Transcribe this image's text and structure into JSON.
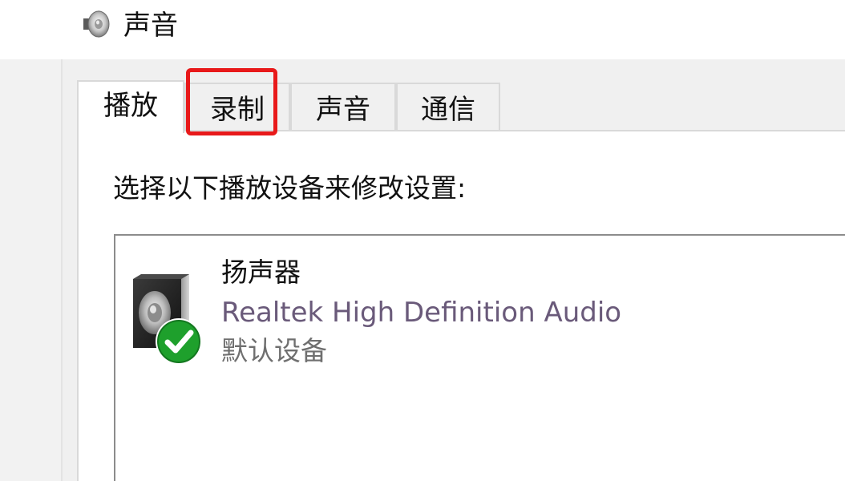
{
  "window": {
    "title": "声音",
    "icon": "speaker-icon"
  },
  "tabs": [
    {
      "label": "播放",
      "active": true
    },
    {
      "label": "录制",
      "active": false,
      "highlighted": true
    },
    {
      "label": "声音",
      "active": false
    },
    {
      "label": "通信",
      "active": false
    }
  ],
  "playback": {
    "instruction": "选择以下播放设备来修改设置:",
    "devices": [
      {
        "name": "扬声器",
        "driver": "Realtek High Definition Audio",
        "status": "默认设备",
        "icon": "speaker-icon",
        "badge": "default-check-icon"
      }
    ]
  },
  "colors": {
    "highlight": "#e8191a",
    "driver_text": "#6a5a7a",
    "status_text": "#6f6f6f",
    "check_badge": "#1ea02c"
  }
}
